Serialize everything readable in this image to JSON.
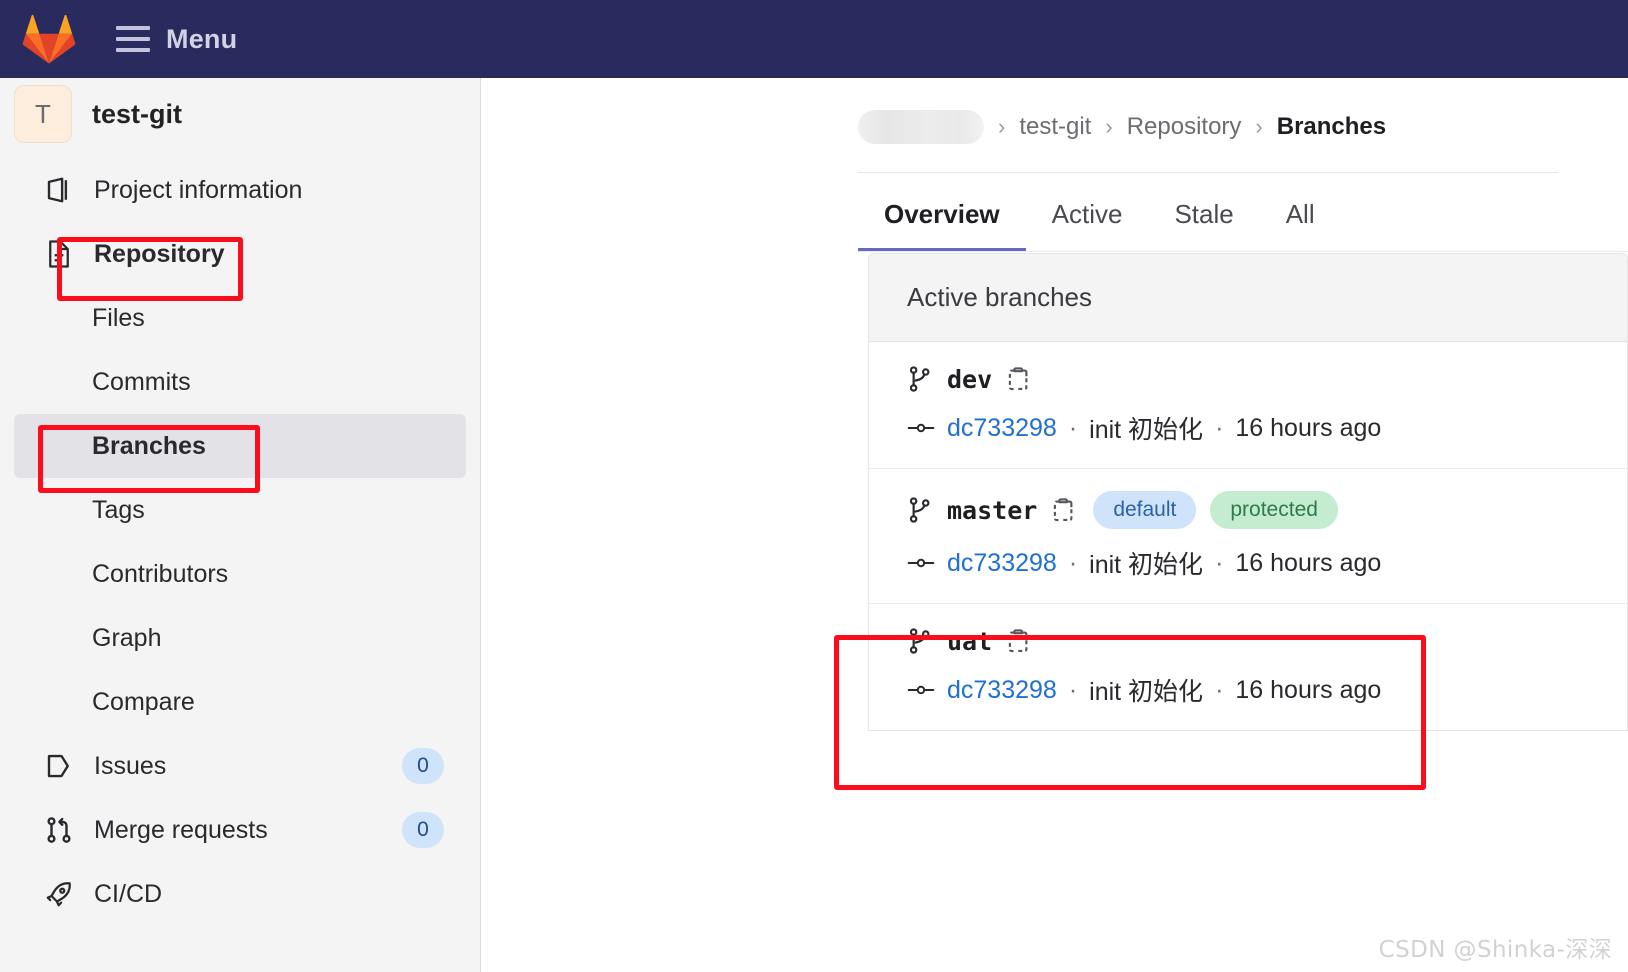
{
  "topbar": {
    "logo_icon": "gitlab-fox-logo",
    "menu_label": "Menu",
    "hamburger_icon": "hamburger-menu-icon",
    "background_color": "#292a5e"
  },
  "sidebar": {
    "project": {
      "avatar_initial": "T",
      "name": "test-git"
    },
    "items": [
      {
        "label": "Project information",
        "icon": "project-info-icon",
        "level": "top",
        "active": false,
        "bold": false,
        "count": null
      },
      {
        "label": "Repository",
        "icon": "repository-file-icon",
        "level": "top",
        "active": false,
        "bold": true,
        "count": null
      },
      {
        "label": "Files",
        "icon": null,
        "level": "sub",
        "active": false,
        "bold": false,
        "count": null
      },
      {
        "label": "Commits",
        "icon": null,
        "level": "sub",
        "active": false,
        "bold": false,
        "count": null
      },
      {
        "label": "Branches",
        "icon": null,
        "level": "sub",
        "active": true,
        "bold": true,
        "count": null
      },
      {
        "label": "Tags",
        "icon": null,
        "level": "sub",
        "active": false,
        "bold": false,
        "count": null
      },
      {
        "label": "Contributors",
        "icon": null,
        "level": "sub",
        "active": false,
        "bold": false,
        "count": null
      },
      {
        "label": "Graph",
        "icon": null,
        "level": "sub",
        "active": false,
        "bold": false,
        "count": null
      },
      {
        "label": "Compare",
        "icon": null,
        "level": "sub",
        "active": false,
        "bold": false,
        "count": null
      },
      {
        "label": "Issues",
        "icon": "issues-icon",
        "level": "top",
        "active": false,
        "bold": false,
        "count": "0"
      },
      {
        "label": "Merge requests",
        "icon": "merge-request-icon",
        "level": "top",
        "active": false,
        "bold": false,
        "count": "0"
      },
      {
        "label": "CI/CD",
        "icon": "rocket-icon",
        "level": "top",
        "active": false,
        "bold": false,
        "count": null
      }
    ]
  },
  "breadcrumb": {
    "redacted_first": true,
    "separator": "›",
    "items": [
      {
        "label": "test-git",
        "current": false
      },
      {
        "label": "Repository",
        "current": false
      },
      {
        "label": "Branches",
        "current": true
      }
    ]
  },
  "tabs": [
    {
      "label": "Overview",
      "active": true
    },
    {
      "label": "Active",
      "active": false
    },
    {
      "label": "Stale",
      "active": false
    },
    {
      "label": "All",
      "active": false
    }
  ],
  "panel": {
    "header": "Active branches",
    "branches": [
      {
        "name": "dev",
        "branch_icon": "branch-icon",
        "copy_icon": "copy-to-clipboard-icon",
        "badges": [],
        "commit_icon": "commit-node-icon",
        "sha": "dc733298",
        "sep1": "·",
        "message": "init 初始化",
        "sep2": "·",
        "time": "16 hours ago"
      },
      {
        "name": "master",
        "branch_icon": "branch-icon",
        "copy_icon": "copy-to-clipboard-icon",
        "badges": [
          {
            "label": "default",
            "kind": "default",
            "color": "#cfe3fa"
          },
          {
            "label": "protected",
            "kind": "protected",
            "color": "#c3ecd1"
          }
        ],
        "commit_icon": "commit-node-icon",
        "sha": "dc733298",
        "sep1": "·",
        "message": "init 初始化",
        "sep2": "·",
        "time": "16 hours ago"
      },
      {
        "name": "uat",
        "branch_icon": "branch-icon",
        "copy_icon": "copy-to-clipboard-icon",
        "badges": [],
        "commit_icon": "commit-node-icon",
        "sha": "dc733298",
        "sep1": "·",
        "message": "init 初始化",
        "sep2": "·",
        "time": "16 hours ago"
      }
    ]
  },
  "annotations": {
    "color": "#fc0d1b",
    "boxes": [
      {
        "name": "repository-highlight"
      },
      {
        "name": "branches-highlight"
      },
      {
        "name": "uat-branch-highlight"
      }
    ]
  },
  "watermark": "CSDN @Shinka-深深"
}
